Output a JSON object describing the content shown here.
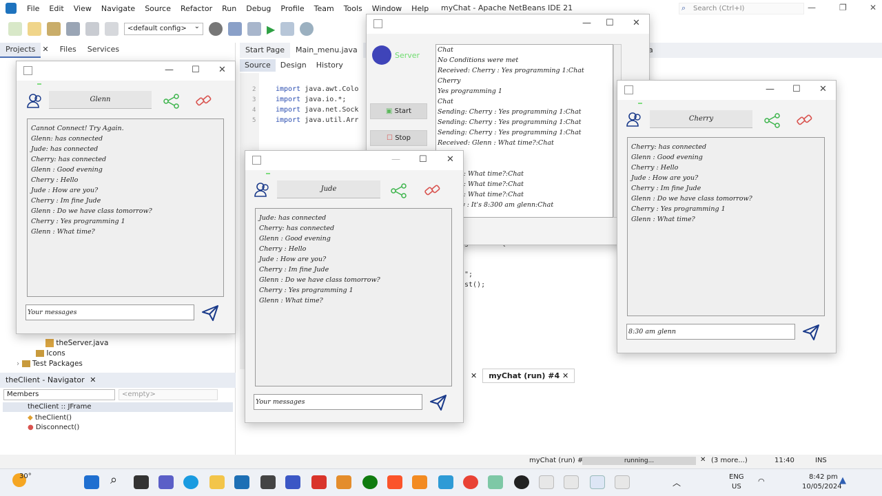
{
  "ide": {
    "title": "myChat - Apache NetBeans IDE 21",
    "menu": [
      "File",
      "Edit",
      "View",
      "Navigate",
      "Source",
      "Refactor",
      "Run",
      "Debug",
      "Profile",
      "Team",
      "Tools",
      "Window",
      "Help"
    ],
    "search_placeholder": "Search (Ctrl+I)",
    "config": "<default config>",
    "panel_tabs": [
      "Projects",
      "Files",
      "Services"
    ],
    "tree": {
      "file1": "theServer.java",
      "icons": "Icons",
      "test_packages": "Test Packages"
    },
    "navigator": {
      "title": "theClient - Navigator",
      "members": "Members",
      "empty": "<empty>",
      "class": "theClient :: JFrame",
      "ctor": "theClient()",
      "method": "Disconnect()"
    },
    "editor_tabs": [
      "Start Page",
      "Main_menu.java",
      "java"
    ],
    "source_tabs": [
      "Source",
      "Design",
      "History"
    ],
    "code_lines": [
      {
        "no": "2",
        "kw": "import",
        "rest": "java.awt.Colo"
      },
      {
        "no": "3",
        "kw": "import",
        "rest": "java.io.*;"
      },
      {
        "no": "4",
        "kw": "import",
        "rest": "java.net.Sock"
      },
      {
        "no": "5",
        "kw": "import",
        "rest": "java.util.Arr"
      }
    ],
    "code_tail": [
      "g.JFrame {",
      "\";",
      "st();"
    ],
    "output_tab": "myChat (run) #4",
    "status": {
      "run": "myChat (run) #4",
      "progress": "running...",
      "more": "(3 more...)",
      "pos": "11:40",
      "mode": "INS"
    }
  },
  "taskbar": {
    "temp": "30°",
    "lang1": "ENG",
    "lang2": "US",
    "time": "8:42 pm",
    "date": "10/05/2024"
  },
  "server": {
    "label": "Server",
    "start": "Start",
    "stop": "Stop",
    "log": [
      "Chat",
      "No Conditions were met",
      "Received: Cherry : Yes programming 1:Chat",
      "Cherry",
      " Yes programming 1",
      "Chat",
      "Sending: Cherry : Yes programming 1:Chat",
      "Sending: Cherry : Yes programming 1:Chat",
      "Sending: Cherry : Yes programming 1:Chat",
      "Received: Glenn : What time?:Chat",
      "Gl",
      "me?",
      ": Glenn : What time?:Chat",
      ": Glenn : What time?:Chat",
      ": Glenn : What time?:Chat",
      ": Cherry : It's 8:300 am glenn:Chat"
    ]
  },
  "clients": {
    "glenn": {
      "name": "Glenn",
      "messages": [
        "Cannot Connect! Try Again.",
        "Glenn: has connected",
        "Jude: has connected",
        "Cherry: has connected",
        "Glenn : Good evening",
        "Cherry : Hello",
        "Jude : How are you?",
        "Cherry : Im fine Jude",
        "Glenn : Do we have class tomorrow?",
        "Cherry : Yes programming 1",
        "Glenn : What time?"
      ],
      "input": "Your messages"
    },
    "jude": {
      "name": "Jude",
      "messages": [
        "Jude: has connected",
        "Cherry: has connected",
        "Glenn : Good evening",
        "Cherry : Hello",
        "Jude : How are you?",
        "Cherry : Im fine Jude",
        "Glenn : Do we have class tomorrow?",
        "Cherry : Yes programming 1",
        "Glenn : What time?"
      ],
      "input": "Your messages"
    },
    "cherry": {
      "name": "Cherry",
      "messages": [
        "Cherry: has connected",
        "Glenn : Good evening",
        "Cherry : Hello",
        "Jude : How are you?",
        "Cherry : Im fine Jude",
        "Glenn : Do we have class tomorrow?",
        "Cherry : Yes programming 1",
        "Glenn : What time?"
      ],
      "input": "8:30 am glenn"
    }
  },
  "colors": {
    "share": "#3cb44b",
    "disconnect": "#d9534f",
    "send": "#1a3a8a",
    "server_green": "#6fdc6f"
  }
}
